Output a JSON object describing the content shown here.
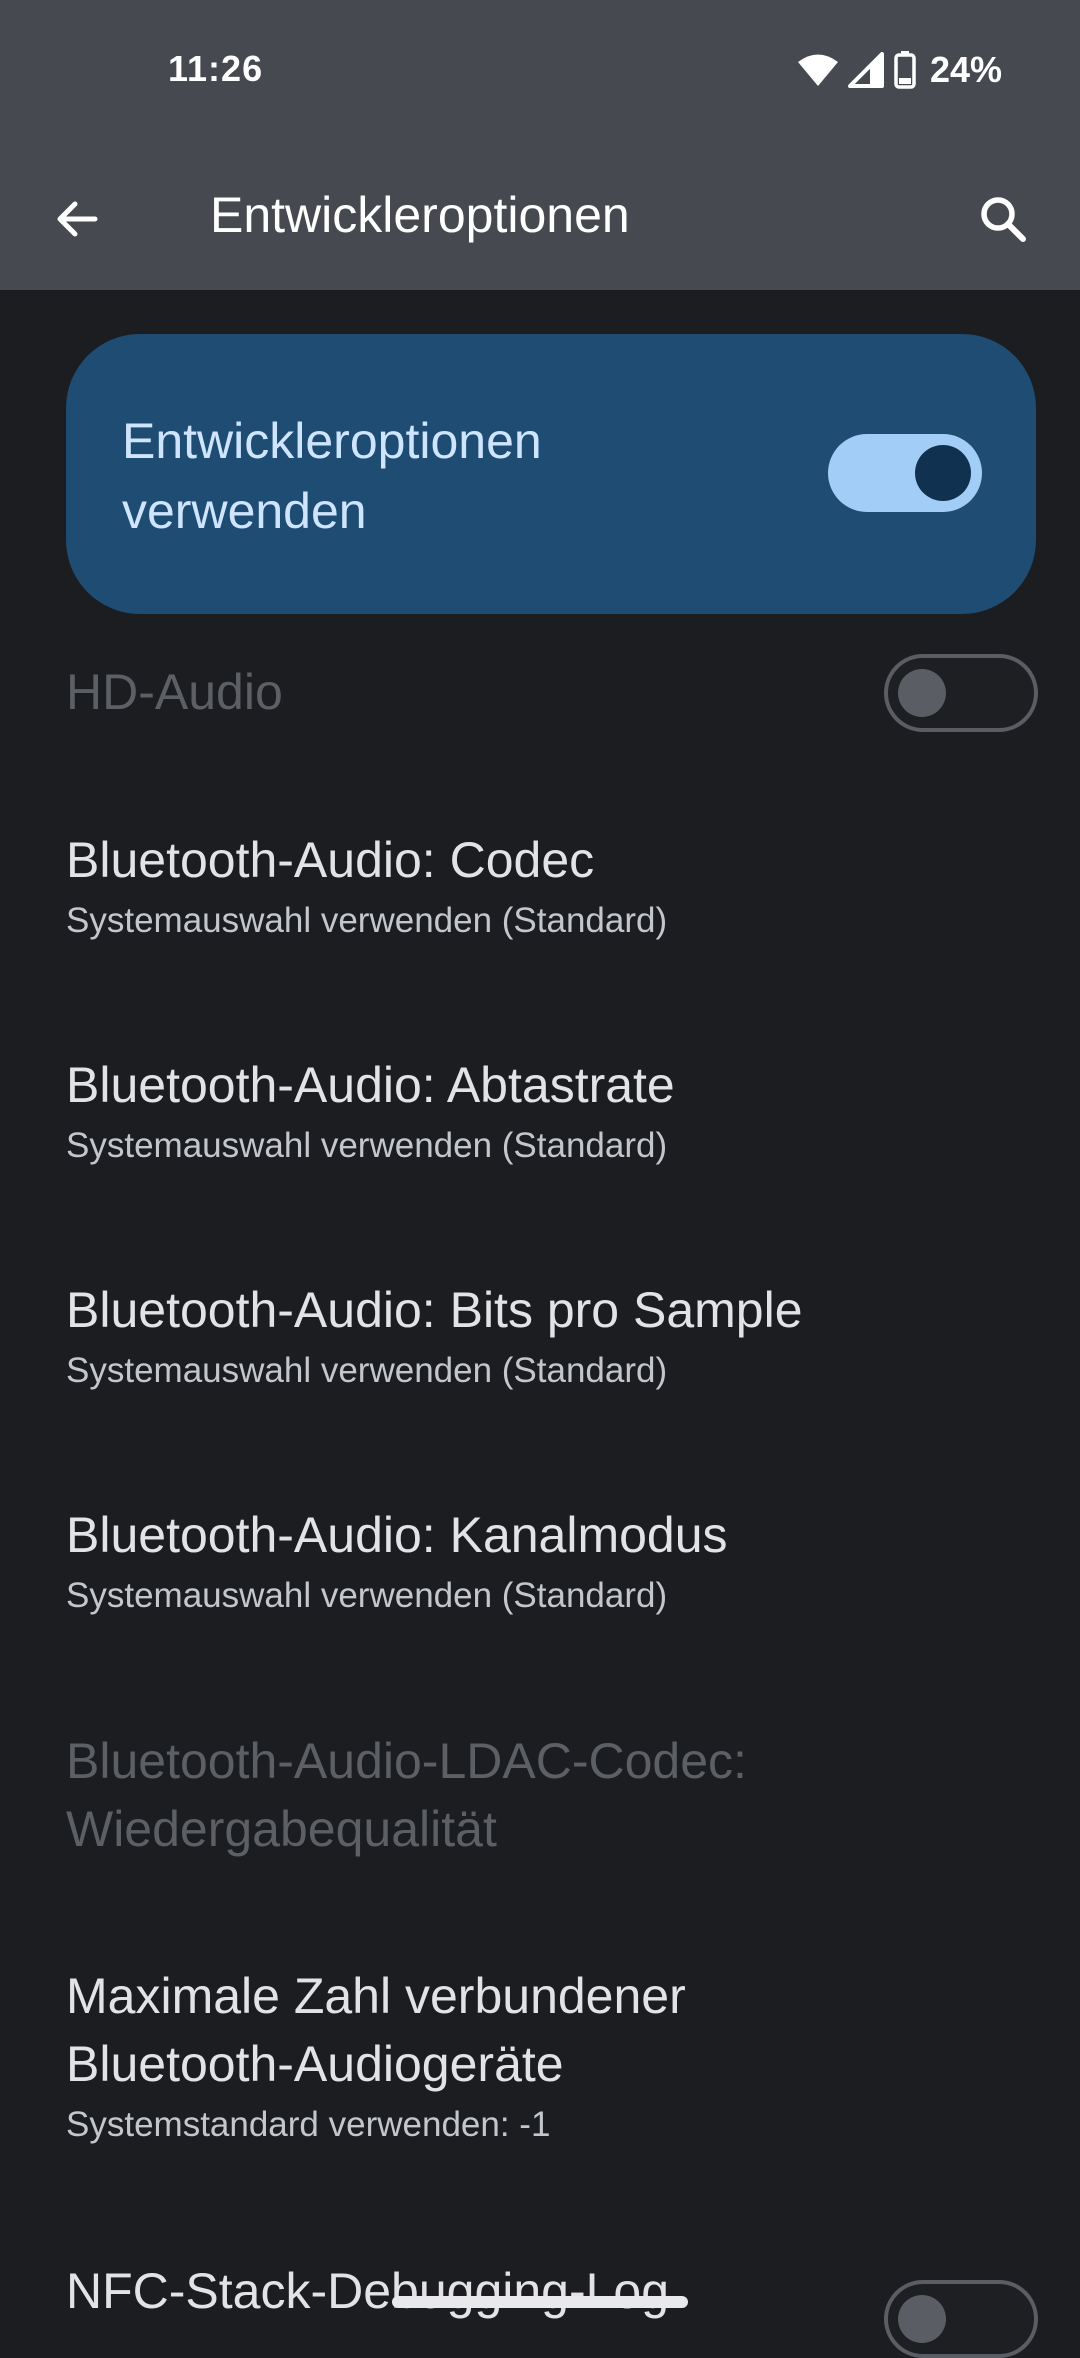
{
  "status_bar": {
    "time": "11:26",
    "battery_percent": "24%",
    "icons": [
      "wifi-icon",
      "cellular-signal-icon",
      "battery-icon"
    ]
  },
  "app_bar": {
    "title": "Entwickleroptionen",
    "back_icon": "arrow-left-icon",
    "search_icon": "search-icon"
  },
  "master_switch": {
    "label": "Entwickleroptionen verwenden",
    "checked": true
  },
  "preferences": [
    {
      "title": "HD-Audio",
      "summary": "",
      "has_switch": true,
      "checked": false,
      "enabled": false
    },
    {
      "title": "Bluetooth-Audio: Codec",
      "summary": "Systemauswahl verwenden (Standard)",
      "enabled": true
    },
    {
      "title": "Bluetooth-Audio: Abtastrate",
      "summary": "Systemauswahl verwenden (Standard)",
      "enabled": true
    },
    {
      "title": "Bluetooth-Audio: Bits pro Sample",
      "summary": "Systemauswahl verwenden (Standard)",
      "enabled": true
    },
    {
      "title": "Bluetooth-Audio: Kanalmodus",
      "summary": "Systemauswahl verwenden (Standard)",
      "enabled": true
    },
    {
      "title": "Bluetooth-Audio-LDAC-Codec: Wiedergabequalität",
      "summary": "",
      "enabled": false
    },
    {
      "title": "Maximale Zahl verbundener Bluetooth-Audiogeräte",
      "summary": "Systemstandard verwenden: -1",
      "enabled": true
    },
    {
      "title": "NFC-Stack-Debugging-Log",
      "summary": "",
      "has_switch": true,
      "checked": false,
      "enabled": true
    }
  ],
  "colors": {
    "background": "#1b1d21",
    "header": "#46494f",
    "card": "#1f4c72",
    "switch_on_track": "#a2cdf7",
    "switch_on_thumb": "#10314f"
  }
}
